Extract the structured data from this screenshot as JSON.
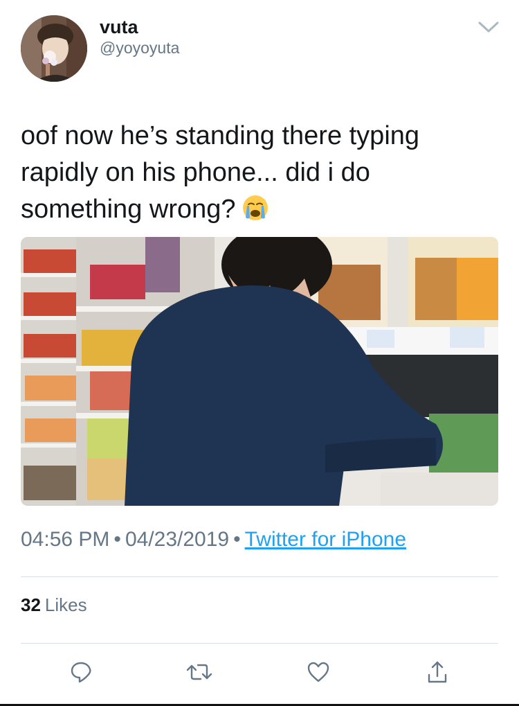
{
  "author": {
    "display_name": "vuta",
    "handle": "@yoyoyuta"
  },
  "tweet": {
    "text_line1": "oof now he’s standing there typing",
    "text_line2": "rapidly on his phone... did i do",
    "text_line3": "something wrong?",
    "emoji": "loudly-crying-face"
  },
  "meta": {
    "time": "04:56 PM",
    "separator": "•",
    "date": "04/23/2019",
    "source": "Twitter for iPhone"
  },
  "stats": {
    "likes_count": "32",
    "likes_label": "Likes"
  },
  "icons": {
    "reply": "reply-icon",
    "retweet": "retweet-icon",
    "like": "heart-icon",
    "share": "share-icon",
    "more": "chevron-down-icon"
  },
  "colors": {
    "text": "#14171a",
    "secondary": "#657786",
    "link": "#1da1f2",
    "divider": "#d8dde1"
  }
}
